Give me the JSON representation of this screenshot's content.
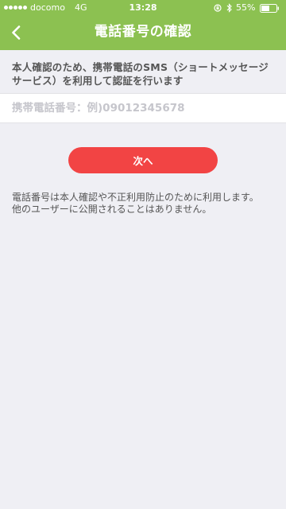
{
  "status_bar": {
    "carrier": "docomo",
    "network": "4G",
    "time": "13:28",
    "battery_percent": "55%",
    "battery_level": 0.55,
    "icons": [
      "signal-dots-icon",
      "orientation-lock-icon",
      "bluetooth-icon",
      "battery-icon"
    ]
  },
  "header": {
    "title": "電話番号の確認",
    "back_icon": "chevron-left-icon",
    "background_color": "#8cc151"
  },
  "main": {
    "description": "本人確認のため、携帯電話のSMS（ショートメッセージサービス）を利用して認証を行います",
    "phone_input": {
      "value": "",
      "placeholder": "携帯電話番号：例)09012345678"
    },
    "next_button_label": "次へ",
    "next_button_color": "#f24444",
    "notice_line1": "電話番号は本人確認や不正利用防止のために利用します。",
    "notice_line2": "他のユーザーに公開されることはありません。"
  }
}
